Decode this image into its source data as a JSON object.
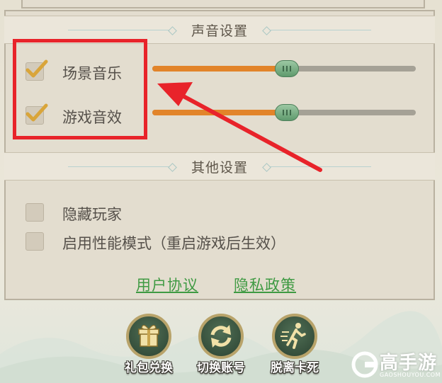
{
  "colors": {
    "panel_bg": "#e3ddcf",
    "accent_orange": "#e2842a",
    "knob_green": "#5f9a6d",
    "link_green": "#3f9a43",
    "annotation_red": "#e8232a"
  },
  "sound_settings": {
    "title": "声音设置",
    "items": [
      {
        "label": "场景音乐",
        "checked": true,
        "volume_fraction": 0.51
      },
      {
        "label": "游戏音效",
        "checked": true,
        "volume_fraction": 0.51
      }
    ]
  },
  "other_settings": {
    "title": "其他设置",
    "items": [
      {
        "label": "隐藏玩家",
        "checked": false
      },
      {
        "label": "启用性能模式（重启游戏后生效）",
        "checked": false
      }
    ]
  },
  "links": {
    "user_agreement": "用户协议",
    "privacy_policy": "隐私政策"
  },
  "bottom_buttons": [
    {
      "label": "礼包兑换",
      "icon": "gift-icon"
    },
    {
      "label": "切换账号",
      "icon": "refresh-icon"
    },
    {
      "label": "脱离卡死",
      "icon": "running-man-icon"
    }
  ],
  "watermark": {
    "brand": "高手游",
    "site": "GAOSHOUYOU.COM"
  }
}
